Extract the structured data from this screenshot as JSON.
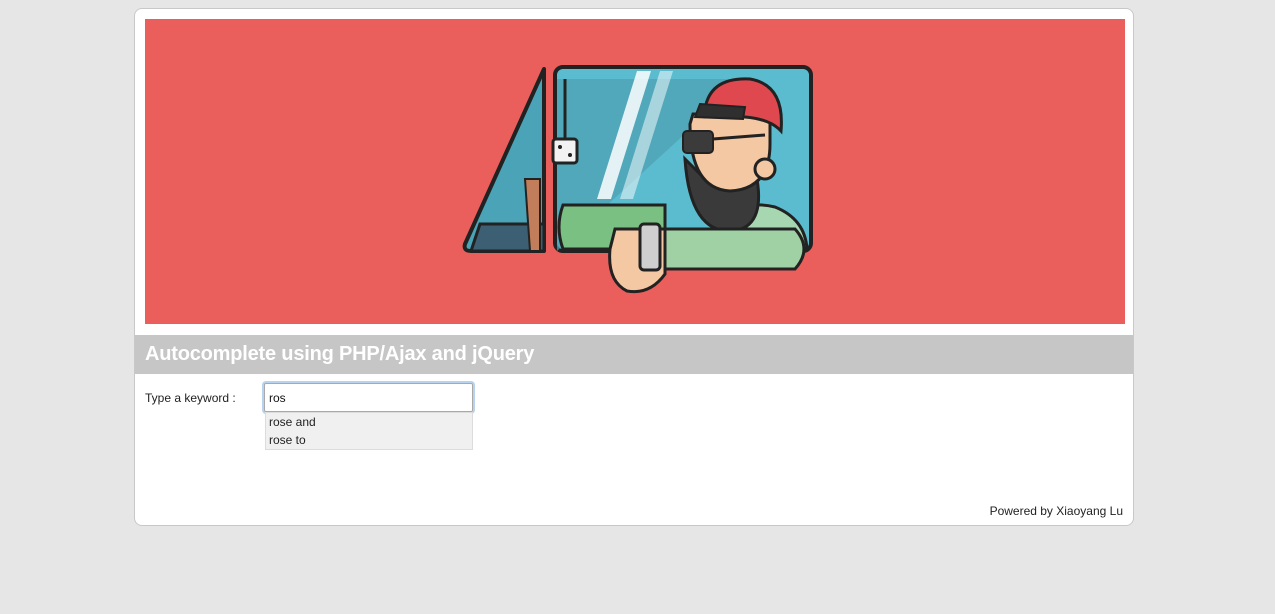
{
  "page": {
    "title": "Autocomplete using PHP/Ajax and jQuery",
    "footer": "Powered by Xiaoyang Lu"
  },
  "form": {
    "label": "Type a keyword :",
    "value": "ros"
  },
  "suggestions": [
    "rose and",
    "rose to"
  ],
  "colors": {
    "page_bg": "#e6e6e6",
    "banner_bg": "#ea5f5c",
    "title_bar_bg": "#c6c6c6",
    "input_focus": "#b7d3ef"
  }
}
